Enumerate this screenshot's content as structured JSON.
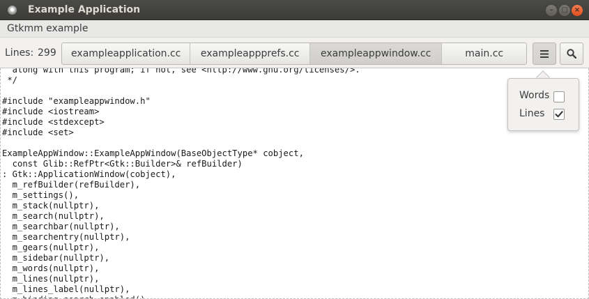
{
  "window": {
    "title": "Example Application",
    "buttons": {
      "minimize": "–",
      "maximize": "□",
      "close": "×"
    }
  },
  "header": {
    "label": "Gtkmm example"
  },
  "toolbar": {
    "lines_caption": "Lines:",
    "lines_count": "299",
    "tabs": [
      {
        "label": "exampleapplication.cc",
        "active": false
      },
      {
        "label": "exampleappprefs.cc",
        "active": false
      },
      {
        "label": "exampleappwindow.cc",
        "active": true
      },
      {
        "label": "main.cc",
        "active": false
      }
    ],
    "menu_icon": "hamburger-menu-icon",
    "search_icon": "search-icon"
  },
  "editor": {
    "lines": [
      "  along with this program; if not, see <http://www.gnu.org/licenses/>.",
      " */",
      "",
      "#include \"exampleappwindow.h\"",
      "#include <iostream>",
      "#include <stdexcept>",
      "#include <set>",
      "",
      "ExampleAppWindow::ExampleAppWindow(BaseObjectType* cobject,",
      "  const Glib::RefPtr<Gtk::Builder>& refBuilder)",
      ": Gtk::ApplicationWindow(cobject),",
      "  m_refBuilder(refBuilder),",
      "  m_settings(),",
      "  m_stack(nullptr),",
      "  m_search(nullptr),",
      "  m_searchbar(nullptr),",
      "  m_searchentry(nullptr),",
      "  m_gears(nullptr),",
      "  m_sidebar(nullptr),",
      "  m_words(nullptr),",
      "  m_lines(nullptr),",
      "  m_lines_label(nullptr),",
      "  m_binding_search_enabled()"
    ]
  },
  "popover": {
    "words_label": "Words",
    "words_checked": false,
    "lines_label": "Lines",
    "lines_checked": true
  }
}
